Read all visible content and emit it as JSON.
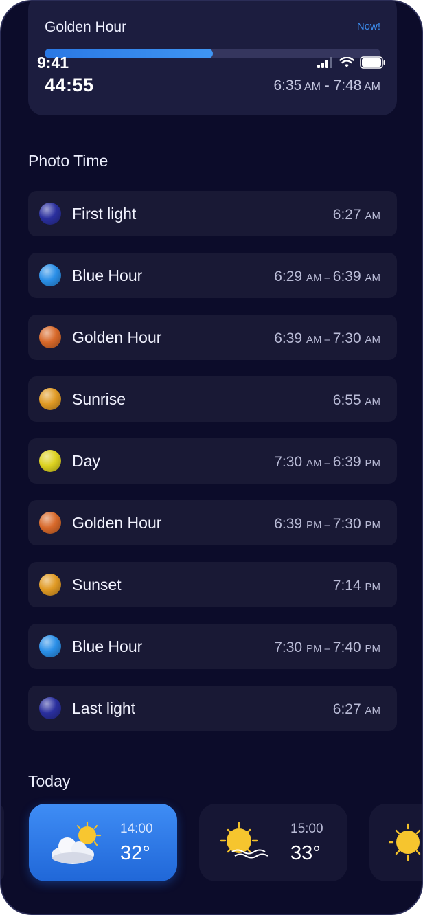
{
  "status_bar": {
    "time": "9:41"
  },
  "golden_hour_card": {
    "title": "Golden Hour",
    "badge": "Now!",
    "countdown": "44:55",
    "start": "6:35",
    "start_unit": "AM",
    "end": "7:48",
    "end_unit": "AM",
    "progress": 0.5
  },
  "photo_time": {
    "title": "Photo Time",
    "items": [
      {
        "label": "First light",
        "color": "#2a2f9e",
        "time": "6:27",
        "time_unit": "AM"
      },
      {
        "label": "Blue Hour",
        "color": "#2a8fe8",
        "start": "6:29",
        "start_unit": "AM",
        "end": "6:39",
        "end_unit": "AM"
      },
      {
        "label": "Golden Hour",
        "color": "#d8692a",
        "start": "6:39",
        "start_unit": "AM",
        "end": "7:30",
        "end_unit": "AM"
      },
      {
        "label": "Sunrise",
        "color": "#e09a24",
        "time": "6:55",
        "time_unit": "AM"
      },
      {
        "label": "Day",
        "color": "#dcd220",
        "start": "7:30",
        "start_unit": "AM",
        "end": "6:39",
        "end_unit": "PM"
      },
      {
        "label": "Golden Hour",
        "color": "#d8692a",
        "start": "6:39",
        "start_unit": "PM",
        "end": "7:30",
        "end_unit": "PM"
      },
      {
        "label": "Sunset",
        "color": "#e09a24",
        "time": "7:14",
        "time_unit": "PM"
      },
      {
        "label": "Blue Hour",
        "color": "#2a8fe8",
        "start": "7:30",
        "start_unit": "PM",
        "end": "7:40",
        "end_unit": "PM"
      },
      {
        "label": "Last light",
        "color": "#2a2f9e",
        "time": "6:27",
        "time_unit": "AM"
      }
    ]
  },
  "today": {
    "title": "Today",
    "forecast": [
      {
        "time": "14:00",
        "temp": "32°",
        "icon": "partly-cloudy-icon"
      },
      {
        "time": "15:00",
        "temp": "33°",
        "icon": "sun-haze-icon"
      },
      {
        "icon": "sun-icon"
      }
    ]
  }
}
